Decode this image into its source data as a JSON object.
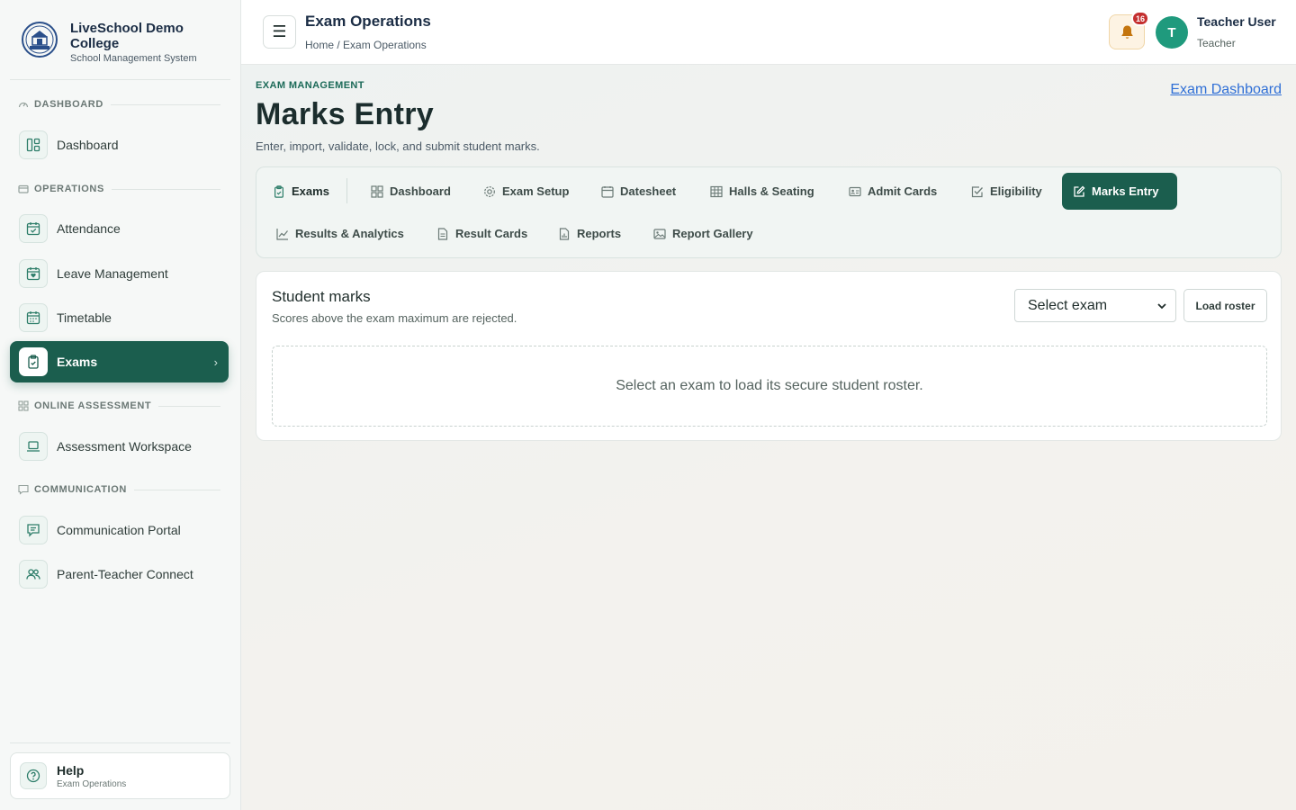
{
  "brand": {
    "name": "LiveSchool Demo College",
    "subtitle": "School Management System"
  },
  "sidebar": {
    "sections": [
      {
        "label": "DASHBOARD",
        "items": [
          {
            "label": "Dashboard",
            "icon": "layout-icon"
          }
        ]
      },
      {
        "label": "OPERATIONS",
        "items": [
          {
            "label": "Attendance",
            "icon": "calendar-check-icon"
          },
          {
            "label": "Leave Management",
            "icon": "calendar-heart-icon"
          },
          {
            "label": "Timetable",
            "icon": "calendar-grid-icon"
          },
          {
            "label": "Exams",
            "icon": "clipboard-icon",
            "active": true
          }
        ]
      },
      {
        "label": "ONLINE ASSESSMENT",
        "items": [
          {
            "label": "Assessment Workspace",
            "icon": "laptop-icon"
          }
        ]
      },
      {
        "label": "COMMUNICATION",
        "items": [
          {
            "label": "Communication Portal",
            "icon": "message-icon"
          },
          {
            "label": "Parent-Teacher Connect",
            "icon": "users-icon"
          }
        ]
      }
    ],
    "help": {
      "title": "Help",
      "subtitle": "Exam Operations"
    }
  },
  "header": {
    "title": "Exam Operations",
    "breadcrumb": "Home / Exam Operations",
    "notifications": "16",
    "user": {
      "initial": "T",
      "name": "Teacher User",
      "role": "Teacher"
    }
  },
  "page": {
    "eyebrow": "EXAM MANAGEMENT",
    "title": "Marks Entry",
    "description": "Enter, import, validate, lock, and submit student marks.",
    "dashboard_link": "Exam Dashboard"
  },
  "tabs": [
    {
      "label": "Exams",
      "icon": "clipboard-icon"
    },
    {
      "label": "Dashboard",
      "icon": "grid-icon"
    },
    {
      "label": "Exam Setup",
      "icon": "gear-icon"
    },
    {
      "label": "Datesheet",
      "icon": "calendar-icon"
    },
    {
      "label": "Halls & Seating",
      "icon": "table-icon"
    },
    {
      "label": "Admit Cards",
      "icon": "id-card-icon"
    },
    {
      "label": "Eligibility",
      "icon": "check-square-icon"
    },
    {
      "label": "Marks Entry",
      "icon": "edit-icon",
      "active": true
    },
    {
      "label": "Results & Analytics",
      "icon": "chart-line-icon"
    },
    {
      "label": "Result Cards",
      "icon": "document-icon"
    },
    {
      "label": "Reports",
      "icon": "report-icon"
    },
    {
      "label": "Report Gallery",
      "icon": "image-icon"
    }
  ],
  "marks_card": {
    "title": "Student marks",
    "subtitle": "Scores above the exam maximum are rejected.",
    "select_value": "Select exam",
    "load_button": "Load roster",
    "empty_message": "Select an exam to load its secure student roster."
  },
  "colors": {
    "primary": "#1b5e4e",
    "accent": "#1f9a7d",
    "badge": "#c42f2f",
    "link": "#2f6fd6"
  }
}
